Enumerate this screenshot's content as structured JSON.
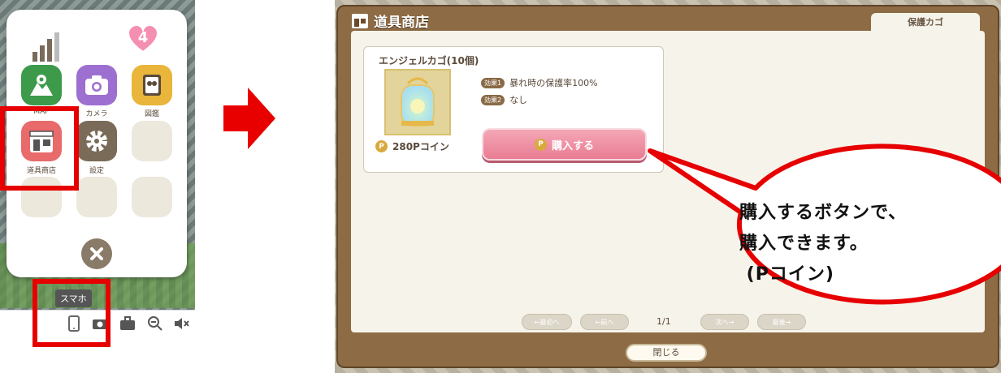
{
  "phone_menu": {
    "notification_count": "4",
    "apps": [
      {
        "label": "MAP"
      },
      {
        "label": "カメラ"
      },
      {
        "label": "図鑑"
      },
      {
        "label": "道具商店"
      },
      {
        "label": "設定"
      }
    ],
    "tooltip": "スマホ"
  },
  "shop": {
    "title": "道具商店",
    "tab_cart": "保護カゴ",
    "item": {
      "name": "エンジェルカゴ(10個)",
      "effects": [
        {
          "badge": "効果1",
          "text": "暴れ時の保護率100%"
        },
        {
          "badge": "効果2",
          "text": "なし"
        }
      ],
      "coin_icon": "P",
      "price": "280Pコイン",
      "buy_label": "購入する"
    },
    "pager": {
      "first": "←最初へ",
      "prev": "←前へ",
      "page": "1/1",
      "next": "次へ→",
      "last": "最後→"
    },
    "close_label": "閉じる"
  },
  "callout": {
    "text": "購入するボタンで、\n購入できます。\n (Pコイン)"
  },
  "colors": {
    "highlight": "#e60000",
    "shop_frame": "#8d6b44",
    "buy_button": "#e97c93"
  }
}
